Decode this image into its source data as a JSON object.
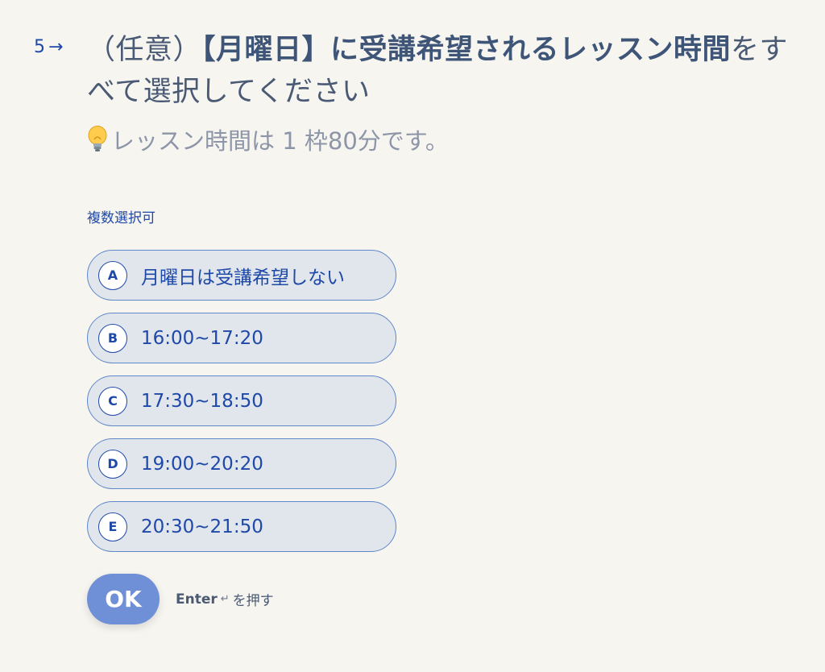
{
  "question": {
    "number": "5",
    "title_prefix": "（任意）",
    "title_bold": "【月曜日】に受講希望されるレッスン時間",
    "title_suffix": "をすべて選択してください",
    "hint": "レッスン時間は 1 枠80分です。",
    "hint_icon": "lightbulb-icon",
    "multi_select_label": "複数選択可"
  },
  "options": [
    {
      "key": "A",
      "label": "月曜日は受講希望しない"
    },
    {
      "key": "B",
      "label": "16:00~17:20"
    },
    {
      "key": "C",
      "label": "17:30~18:50"
    },
    {
      "key": "D",
      "label": "19:00~20:20"
    },
    {
      "key": "E",
      "label": "20:30~21:50"
    }
  ],
  "submit": {
    "ok_label": "OK",
    "enter_word": "Enter",
    "enter_icon": "return-icon",
    "enter_suffix": "を押す"
  },
  "colors": {
    "background": "#f7f5f0",
    "accent": "#1f49a8",
    "option_fill": "#e1e5ec",
    "option_border": "#5f87c9",
    "ok_button": "#6f8fd6"
  }
}
